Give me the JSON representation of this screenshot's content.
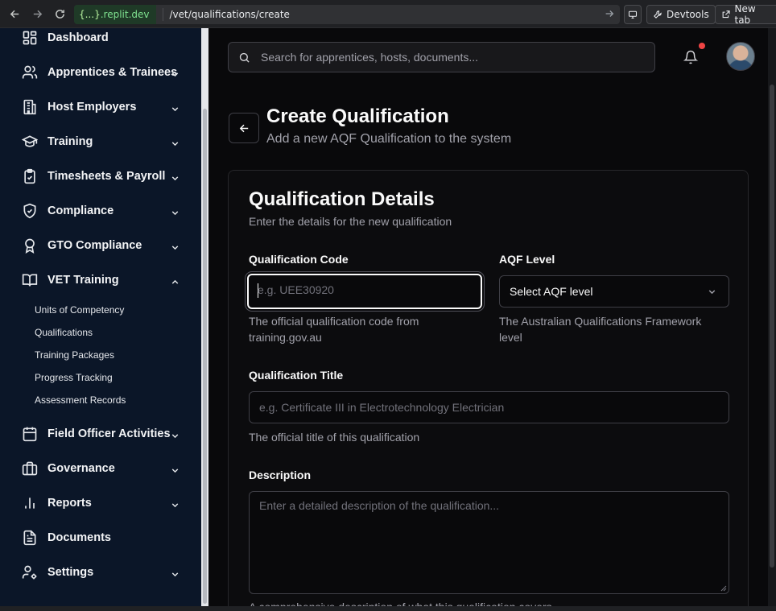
{
  "browser": {
    "url_host_brace": "{...}",
    "url_host": ".replit.dev",
    "url_path": "/vet/qualifications/create",
    "devtools_label": "Devtools",
    "new_tab_label": "New tab"
  },
  "sidebar": {
    "items": [
      {
        "label": "Dashboard",
        "icon": "dashboard-icon",
        "expandable": false
      },
      {
        "label": "Apprentices & Trainees",
        "icon": "users-icon",
        "expandable": true
      },
      {
        "label": "Host Employers",
        "icon": "building-icon",
        "expandable": true
      },
      {
        "label": "Training",
        "icon": "graduation-cap-icon",
        "expandable": true
      },
      {
        "label": "Timesheets & Payroll",
        "icon": "clipboard-check-icon",
        "expandable": true
      },
      {
        "label": "Compliance",
        "icon": "shield-check-icon",
        "expandable": true
      },
      {
        "label": "GTO Compliance",
        "icon": "award-icon",
        "expandable": true
      },
      {
        "label": "VET Training",
        "icon": "book-open-icon",
        "expandable": true,
        "expanded": true
      },
      {
        "label": "Field Officer Activities",
        "icon": "calendar-icon",
        "expandable": true
      },
      {
        "label": "Governance",
        "icon": "briefcase-icon",
        "expandable": true
      },
      {
        "label": "Reports",
        "icon": "bar-chart-icon",
        "expandable": true
      },
      {
        "label": "Documents",
        "icon": "file-text-icon",
        "expandable": false
      },
      {
        "label": "Settings",
        "icon": "user-cog-icon",
        "expandable": true
      }
    ],
    "vet_sub_items": [
      {
        "label": "Units of Competency"
      },
      {
        "label": "Qualifications"
      },
      {
        "label": "Training Packages"
      },
      {
        "label": "Progress Tracking"
      },
      {
        "label": "Assessment Records"
      }
    ]
  },
  "header": {
    "search_placeholder": "Search for apprentices, hosts, documents...",
    "notification_dot_color": "#ef4444"
  },
  "page": {
    "title": "Create Qualification",
    "subtitle": "Add a new AQF Qualification to the system"
  },
  "card": {
    "title": "Qualification Details",
    "subtitle": "Enter the details for the new qualification"
  },
  "form": {
    "code": {
      "label": "Qualification Code",
      "value": "",
      "placeholder": "e.g. UEE30920",
      "help_line1": "The official qualification code from",
      "help_line2": "training.gov.au"
    },
    "aqf": {
      "label": "AQF Level",
      "selected": "Select AQF level",
      "help_line1": "The Australian Qualifications Framework",
      "help_line2": "level"
    },
    "title": {
      "label": "Qualification Title",
      "value": "",
      "placeholder": "e.g. Certificate III in Electrotechnology Electrician",
      "help": "The official title of this qualification"
    },
    "description": {
      "label": "Description",
      "value": "",
      "placeholder": "Enter a detailed description of the qualification...",
      "help": "A comprehensive description of what this qualification covers"
    }
  }
}
